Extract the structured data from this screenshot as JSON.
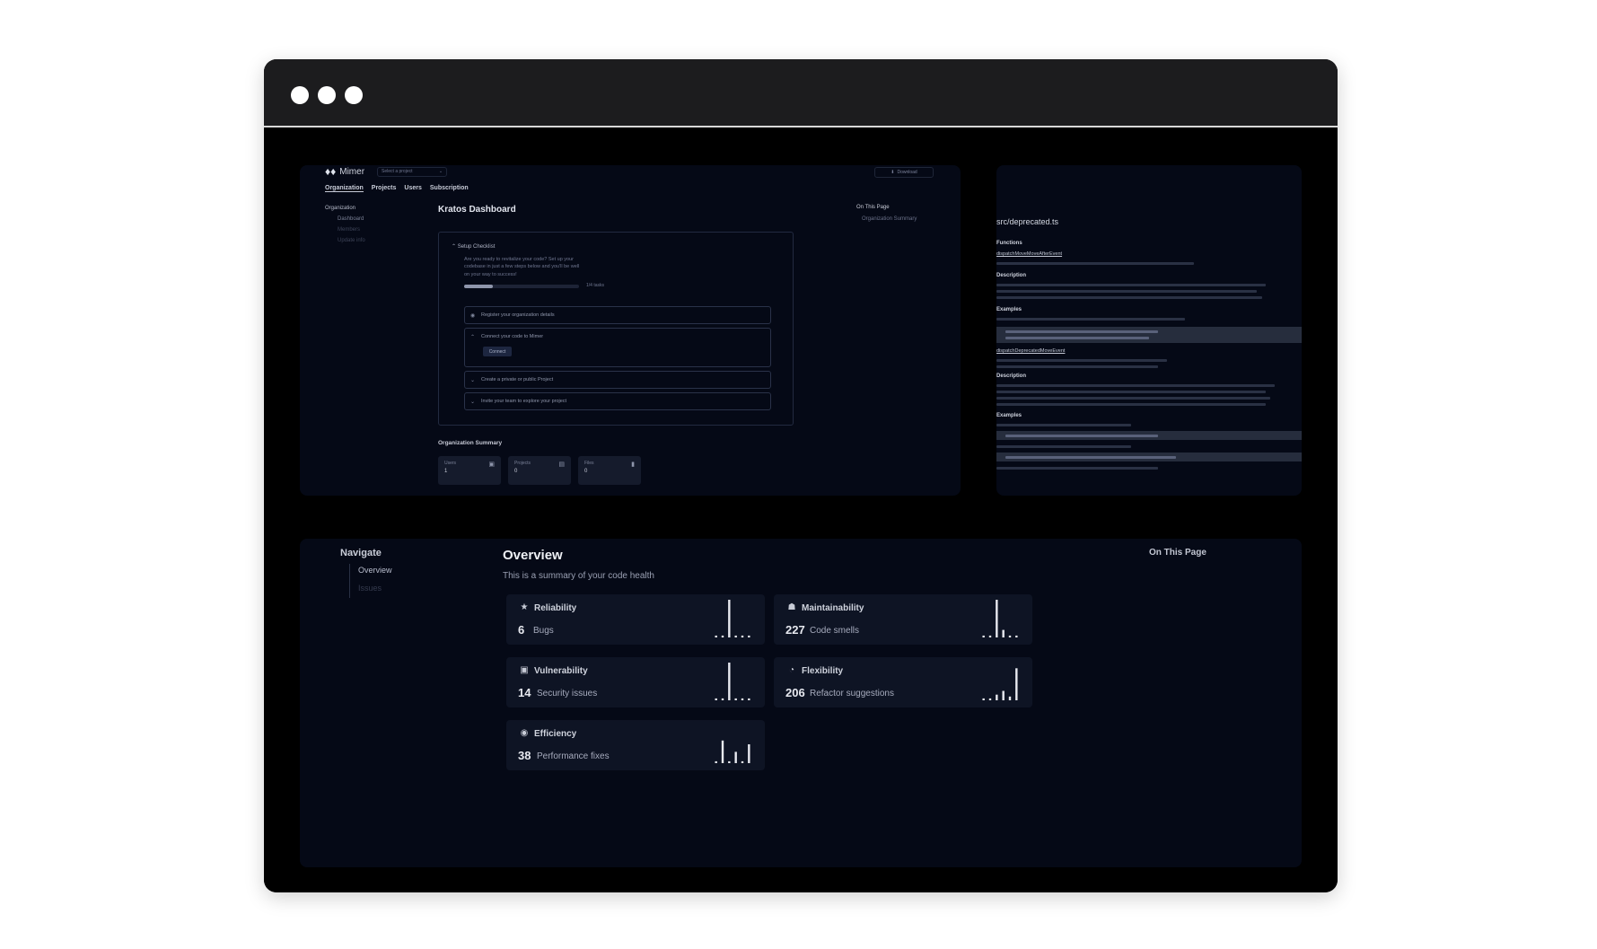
{
  "dashboard": {
    "brand": "Mimer",
    "org_select": "Select a project",
    "org_button": "Download",
    "nav": [
      "Organization",
      "Projects",
      "Users",
      "Subscription"
    ],
    "sidebar": {
      "heading": "Organization",
      "items": [
        "Dashboard",
        "Members",
        "Update info"
      ]
    },
    "title": "Kratos Dashboard",
    "on_this_page": {
      "heading": "On This Page",
      "items": [
        "Organization Summary"
      ]
    },
    "checklist": {
      "title": "Setup Checklist",
      "description": "Are you ready to revitalize your code? Set up your codebase in just a few steps below and you'll be well on your way to success!",
      "progress": 0.25,
      "progress_label": "1/4 tasks",
      "items": [
        {
          "label": "Register your organization details",
          "state": "done"
        },
        {
          "label": "Connect your code to Mimer",
          "state": "open",
          "action": "Connect"
        },
        {
          "label": "Create a private or public Project",
          "state": "collapsed"
        },
        {
          "label": "Invite your team to explore your project",
          "state": "collapsed"
        }
      ]
    },
    "summary": {
      "title": "Organization Summary",
      "cards": [
        {
          "label": "Users",
          "value": "1",
          "icon": "users-icon"
        },
        {
          "label": "Projects",
          "value": "0",
          "icon": "folder-icon"
        },
        {
          "label": "Files",
          "value": "0",
          "icon": "file-icon"
        }
      ]
    }
  },
  "docs": {
    "file_title": "src/deprecated.ts",
    "sections": {
      "functions": "Functions",
      "description": "Description",
      "examples": "Examples"
    },
    "function_1": "dispatchMoveMoveAfterEvent",
    "function_2": "dispatchDeprecatedMoveEvent"
  },
  "overview": {
    "navigate_title": "Navigate",
    "nav_items": [
      "Overview",
      "Issues"
    ],
    "title": "Overview",
    "subtitle": "This is a summary of your code health",
    "on_this_page": "On This Page",
    "cards": [
      {
        "label": "Reliability",
        "value": "6",
        "unit": "Bugs",
        "icon": "star-icon",
        "bars": [
          0.05,
          0.05,
          1.0,
          0.05,
          0.05,
          0.05
        ]
      },
      {
        "label": "Maintainability",
        "value": "227",
        "unit": "Code smells",
        "icon": "shield-icon",
        "bars": [
          0.05,
          0.05,
          1.0,
          0.2,
          0.05,
          0.05
        ]
      },
      {
        "label": "Vulnerability",
        "value": "14",
        "unit": "Security issues",
        "icon": "lock-icon",
        "bars": [
          0.05,
          0.05,
          1.0,
          0.05,
          0.05,
          0.05
        ]
      },
      {
        "label": "Flexibility",
        "value": "206",
        "unit": "Refactor suggestions",
        "icon": "gauge-icon",
        "bars": [
          0.05,
          0.05,
          0.15,
          0.25,
          0.1,
          0.85
        ]
      },
      {
        "label": "Efficiency",
        "value": "38",
        "unit": "Performance fixes",
        "icon": "bolt-icon",
        "bars": [
          0.05,
          0.6,
          0.05,
          0.3,
          0.05,
          0.5
        ]
      }
    ]
  }
}
